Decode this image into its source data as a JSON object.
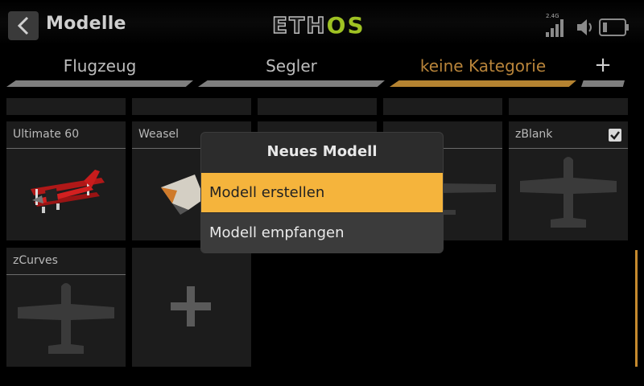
{
  "header": {
    "title": "Modelle",
    "logo_left": "ETH",
    "logo_right": "OS",
    "signal_label": "2.4G"
  },
  "tabs": [
    {
      "label": "Flugzeug",
      "active": false
    },
    {
      "label": "Segler",
      "active": false
    },
    {
      "label": "keine Kategorie",
      "active": true
    },
    {
      "label": "+",
      "active": false
    }
  ],
  "models": [
    {
      "name": "Ultimate 60",
      "icon": "biplane-image"
    },
    {
      "name": "Weasel",
      "icon": "flying-wing-image"
    },
    {
      "name": "",
      "icon": "plane-silhouette"
    },
    {
      "name": "",
      "icon": "plane-silhouette"
    },
    {
      "name": "zBlank",
      "icon": "plane-silhouette",
      "selected": true
    },
    {
      "name": "zCurves",
      "icon": "plane-silhouette"
    }
  ],
  "add_model_symbol": "+",
  "dialog": {
    "title": "Neues  Modell",
    "options": [
      "Modell erstellen",
      "Modell empfangen"
    ],
    "selected_index": 0
  },
  "colors": {
    "accent": "#f5b43c",
    "active_tab": "#b58331",
    "logo_green": "#9fc223"
  }
}
